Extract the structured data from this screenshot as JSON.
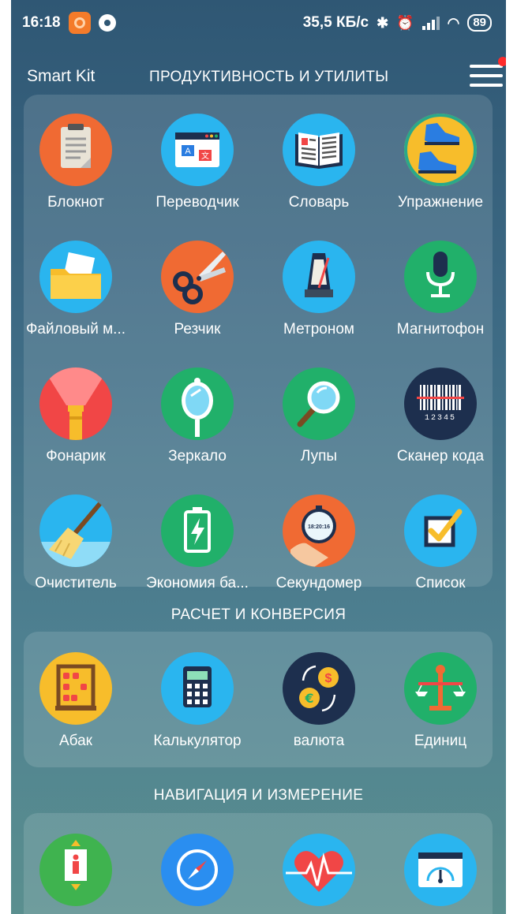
{
  "status_bar": {
    "time": "16:18",
    "network_speed": "35,5 КБ/с",
    "battery": "89"
  },
  "header": {
    "app_title": "Smart Kit",
    "section_title": "ПРОДУКТИВНОСТЬ И УТИЛИТЫ"
  },
  "productivity": {
    "items": [
      {
        "label": "Блокнот",
        "icon": "notepad-icon"
      },
      {
        "label": "Переводчик",
        "icon": "translator-icon"
      },
      {
        "label": "Словарь",
        "icon": "dictionary-icon"
      },
      {
        "label": "Упражнение",
        "icon": "sneaker-icon"
      },
      {
        "label": "Файловый м...",
        "icon": "folder-icon"
      },
      {
        "label": "Резчик",
        "icon": "scissors-icon"
      },
      {
        "label": "Метроном",
        "icon": "metronome-icon"
      },
      {
        "label": "Магнитофон",
        "icon": "microphone-icon"
      },
      {
        "label": "Фонарик",
        "icon": "flashlight-icon"
      },
      {
        "label": "Зеркало",
        "icon": "mirror-icon"
      },
      {
        "label": "Лупы",
        "icon": "magnifier-icon"
      },
      {
        "label": "Сканер кода",
        "icon": "barcode-icon"
      },
      {
        "label": "Очиститель",
        "icon": "broom-icon"
      },
      {
        "label": "Экономия ба...",
        "icon": "battery-icon"
      },
      {
        "label": "Секундомер",
        "icon": "stopwatch-icon"
      },
      {
        "label": "Список",
        "icon": "checklist-icon"
      }
    ]
  },
  "calculation": {
    "title": "РАСЧЕТ И КОНВЕРСИЯ",
    "items": [
      {
        "label": "Абак",
        "icon": "abacus-icon"
      },
      {
        "label": "Калькулятор",
        "icon": "calculator-icon"
      },
      {
        "label": "валюта",
        "icon": "currency-icon"
      },
      {
        "label": "Единиц",
        "icon": "scale-icon"
      }
    ]
  },
  "navigation": {
    "title": "НАВИГАЦИЯ И ИЗМЕРЕНИЕ",
    "items": [
      {
        "icon": "elevator-icon"
      },
      {
        "icon": "compass-icon"
      },
      {
        "icon": "heart-rate-icon"
      },
      {
        "icon": "speedometer-icon"
      }
    ]
  },
  "barcode_digits": "12345",
  "stopwatch_time": "18:20:16",
  "colors": {
    "orange": "#f06a33",
    "blue": "#2ab5ef",
    "green": "#21b06a",
    "yellow": "#f7bd2b",
    "red": "#f14646",
    "navy": "#1d2f4e",
    "notification": "#ff2b2b"
  }
}
